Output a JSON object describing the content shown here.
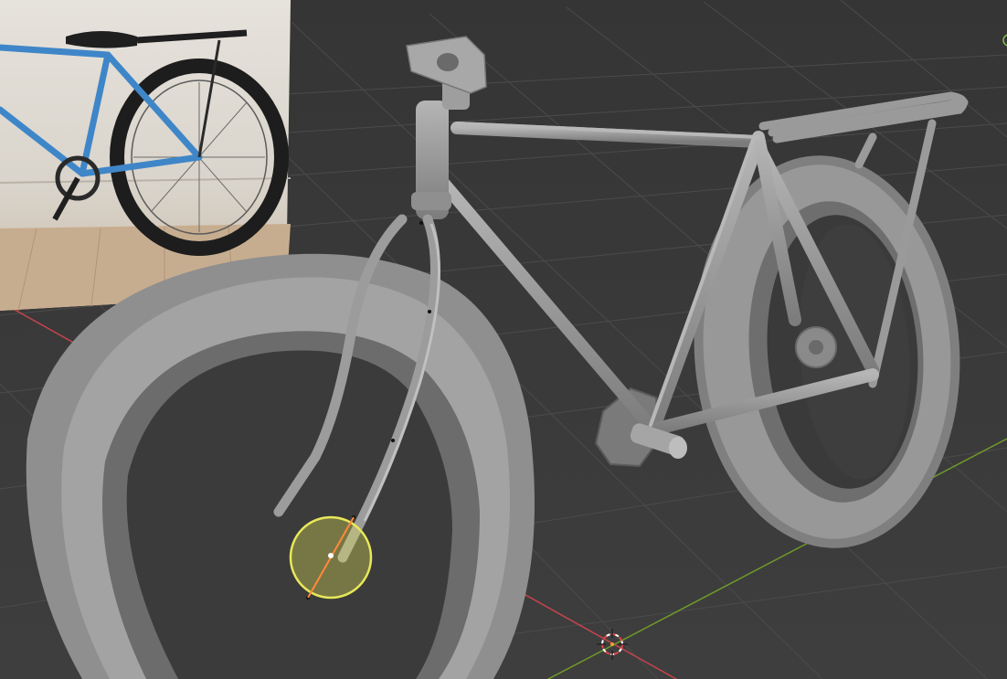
{
  "app": "3D viewport",
  "viewport": {
    "background_color": "#3a3a3a",
    "grid_color": "#4a4a4a",
    "x_axis_color": "#c5444c",
    "y_axis_color": "#6f9a2a"
  },
  "reference_image": {
    "description_name": "bicycle-reference-photo",
    "subject_color": "#3f86c8"
  },
  "model": {
    "name": "bicycle-model",
    "material_color": "#8e8e8e"
  },
  "selection": {
    "proportional_edit_circle_color": "#e8e85a",
    "active_edge_color": "#ff8a3a"
  },
  "cursor": {
    "name": "3d-cursor"
  }
}
